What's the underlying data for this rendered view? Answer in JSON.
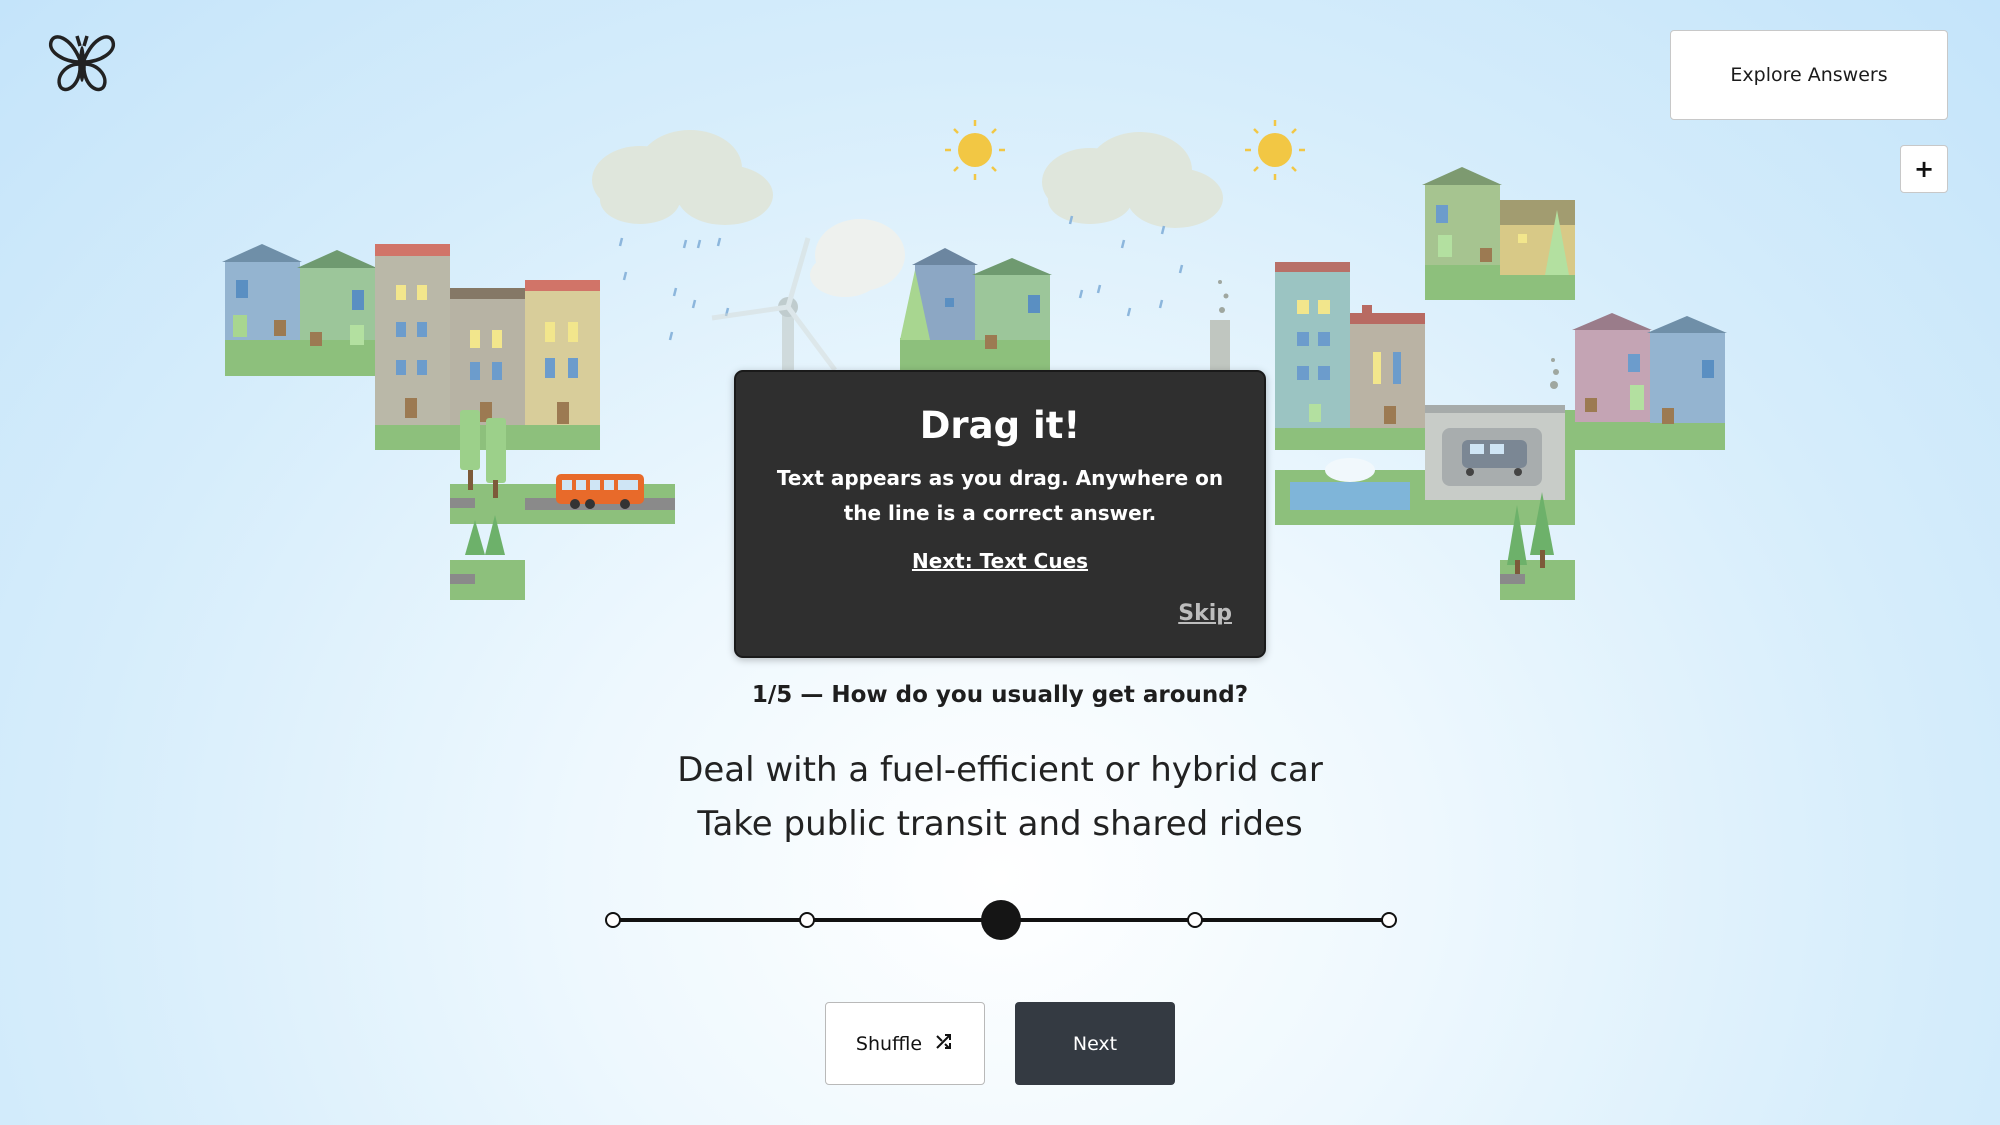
{
  "header": {
    "logo_icon": "butterfly-icon",
    "explore_label": "Explore Answers",
    "expand_label": "+"
  },
  "tooltip": {
    "title": "Drag it!",
    "body": "Text appears as you drag. Anywhere on the line is a correct answer.",
    "next_link": "Next: Text Cues",
    "skip_link": "Skip"
  },
  "question": {
    "text": "1/5 — How do you usually get around?",
    "answer_line1": "Deal with a fuel-efficient or hybrid car",
    "answer_line2": "Take public transit and shared rides"
  },
  "slider": {
    "stops": 5,
    "value": 0.5
  },
  "actions": {
    "shuffle_label": "Shuffle",
    "shuffle_icon": "shuffle-icon",
    "next_label": "Next"
  },
  "colors": {
    "tooltip_bg": "#2f2f2f",
    "next_button_bg": "#343a42",
    "sky": "#c4e4fa"
  }
}
